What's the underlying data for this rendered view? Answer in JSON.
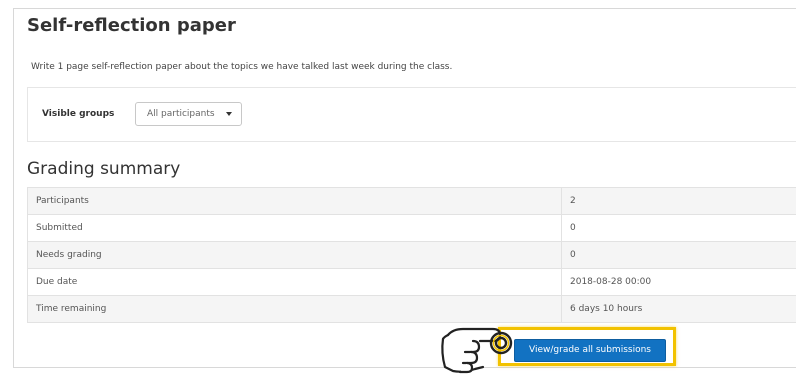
{
  "assignment": {
    "title": "Self-reflection paper",
    "description": "Write 1 page self-reflection paper about the topics we have talked last week during the class."
  },
  "groups": {
    "label": "Visible groups",
    "selected": "All participants"
  },
  "grading_summary": {
    "title": "Grading summary",
    "rows": [
      {
        "label": "Participants",
        "value": "2"
      },
      {
        "label": "Submitted",
        "value": "0"
      },
      {
        "label": "Needs grading",
        "value": "0"
      },
      {
        "label": "Due date",
        "value": "2018-08-28 00:00"
      },
      {
        "label": "Time remaining",
        "value": "6 days 10 hours"
      }
    ]
  },
  "actions": {
    "view_grade_label": "View/grade all submissions"
  },
  "colors": {
    "button": "#1272c2",
    "highlight": "#f2c200"
  },
  "icons": {
    "pointer": "pointing-hand-icon"
  }
}
